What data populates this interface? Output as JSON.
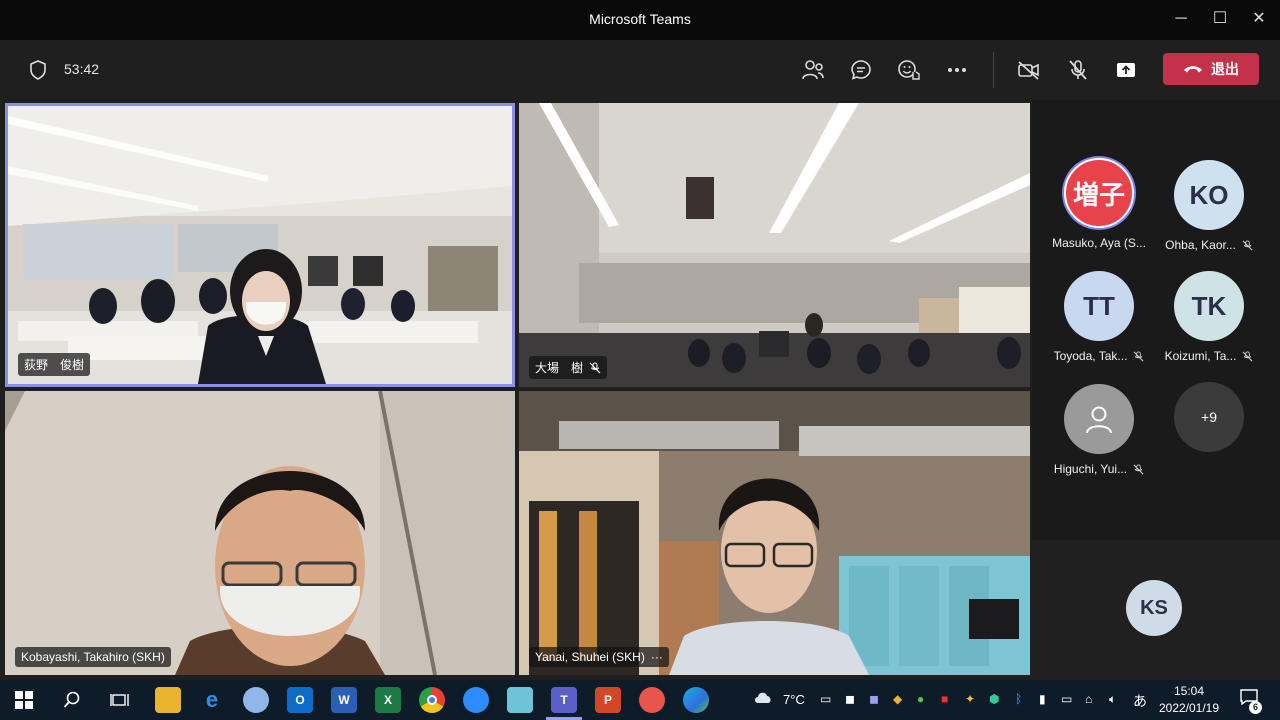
{
  "window": {
    "title": "Microsoft Teams"
  },
  "toolbar": {
    "timer": "53:42",
    "leave_label": "退出"
  },
  "tiles": [
    {
      "name": "荻野　俊樹",
      "muted": false
    },
    {
      "name": "大場　樹",
      "muted": true
    },
    {
      "name": "Kobayashi, Takahiro (SKH)",
      "muted": false
    },
    {
      "name": "Yanai, Shuhei (SKH)",
      "more": "···"
    }
  ],
  "participants": [
    {
      "initials": "増子",
      "name": "Masuko, Aya (S...",
      "muted": false,
      "color": "#e8434b"
    },
    {
      "initials": "KO",
      "name": "Ohba, Kaor...",
      "muted": true,
      "color": "#cfe0ee"
    },
    {
      "initials": "TT",
      "name": "Toyoda, Tak...",
      "muted": true,
      "color": "#c8d8ee"
    },
    {
      "initials": "TK",
      "name": "Koizumi, Ta...",
      "muted": true,
      "color": "#cfe2e6"
    },
    {
      "initials": "",
      "name": "Higuchi, Yui...",
      "muted": true,
      "color": "#9a9a9a"
    }
  ],
  "overflow": {
    "label": "+9"
  },
  "self_view": {
    "initials": "KS"
  },
  "taskbar": {
    "weather": "7°C",
    "time": "15:04",
    "date": "2022/01/19",
    "ime": "あ",
    "notifications": "6",
    "apps": [
      "file-explorer",
      "internet-explorer",
      "paint",
      "outlook",
      "word",
      "excel",
      "chrome",
      "zoom",
      "notepad",
      "teams",
      "powerpoint",
      "snip",
      "edge"
    ]
  },
  "colors": {
    "accent": "#7b83eb",
    "leave": "#c4314b",
    "titlebar": "#0a0a0a",
    "taskbar": "#0e1c2a"
  }
}
